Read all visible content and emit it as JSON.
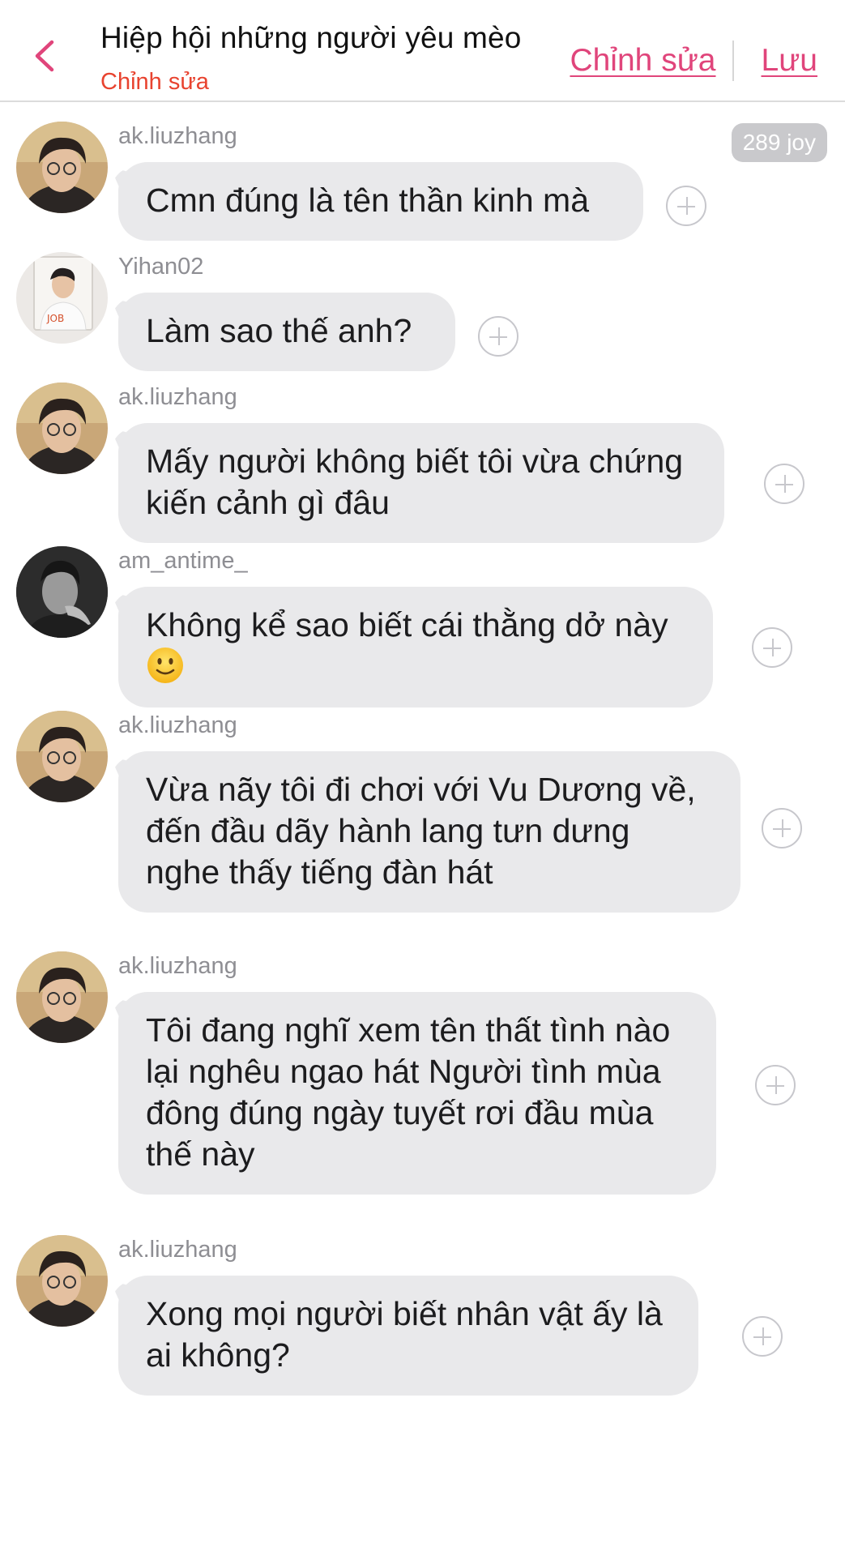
{
  "header": {
    "title": "Hiệp hội những người yêu mèo",
    "subtitle": "Chỉnh sửa",
    "edit_label": "Chỉnh sửa",
    "save_label": "Lưu",
    "accent_color": "#e0457b",
    "subtitle_color": "#e8432f"
  },
  "messages": [
    {
      "user": "ak.liuzhang",
      "text": "Cmn đúng là tên thần kinh mà",
      "badge": "289 joy"
    },
    {
      "user": "Yihan02",
      "text": "Làm sao thế anh?"
    },
    {
      "user": "ak.liuzhang",
      "text": "Mấy người không biết tôi vừa chứng kiến cảnh gì đâu"
    },
    {
      "user": "am_antime_",
      "text": "Không kể sao biết cái thằng dở này",
      "emoji": "slightly-smiling-face"
    },
    {
      "user": "ak.liuzhang",
      "text": "Vừa nãy tôi đi chơi với Vu Dương về, đến đầu dãy hành lang tưn dưng nghe thấy tiếng đàn hát"
    },
    {
      "user": "ak.liuzhang",
      "text": "Tôi đang nghĩ xem tên thất tình nào lại nghêu ngao hát Người tình mùa đông đúng ngày tuyết rơi đầu mùa thế này"
    },
    {
      "user": "ak.liuzhang",
      "text": "Xong mọi người biết nhân vật ấy là ai không?"
    }
  ]
}
